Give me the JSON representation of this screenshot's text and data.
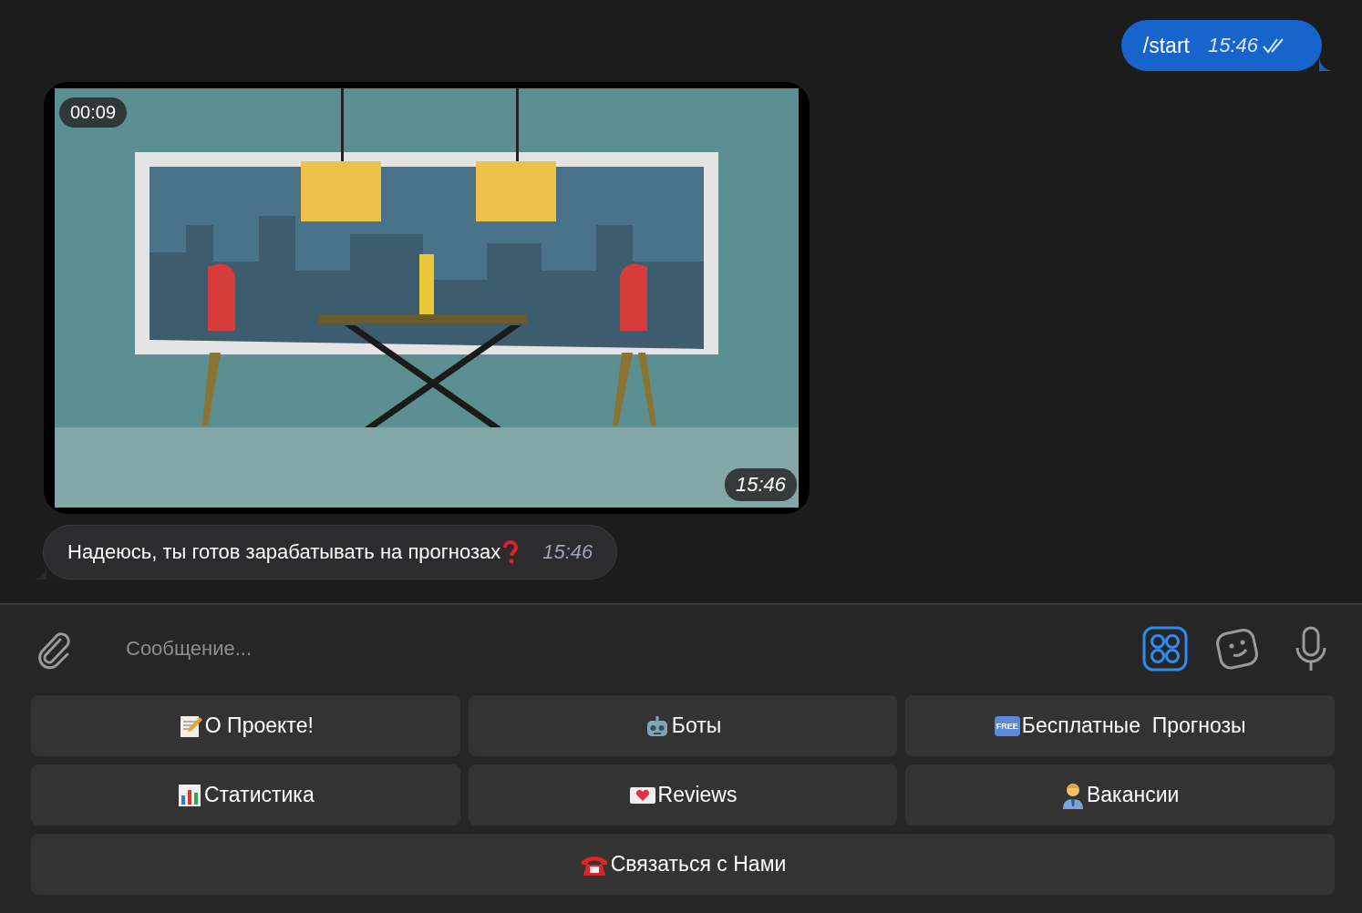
{
  "messages": [
    {
      "kind": "outgoing",
      "text": "/start",
      "time": "15:46",
      "read": true
    },
    {
      "kind": "video",
      "duration": "00:09",
      "time": "15:46"
    },
    {
      "kind": "incoming",
      "text": "Надеюсь, ты готов зарабатывать на прогнозах",
      "time": "15:46"
    }
  ],
  "composer": {
    "placeholder": "Сообщение...",
    "keyboard_toggle_active": true
  },
  "keyboard": [
    [
      {
        "kind": "memo",
        "label": "О Проекте!"
      },
      {
        "kind": "robot",
        "label": "Боты"
      },
      {
        "kind": "free",
        "badge": "FREE",
        "label": "Бесплатные  Прогнозы"
      }
    ],
    [
      {
        "kind": "chart",
        "label": "Статистика"
      },
      {
        "kind": "letter",
        "label": "Reviews"
      },
      {
        "kind": "worker",
        "label": "Вакансии"
      }
    ],
    [
      {
        "kind": "phone",
        "label": "Связаться с Нами"
      }
    ]
  ]
}
